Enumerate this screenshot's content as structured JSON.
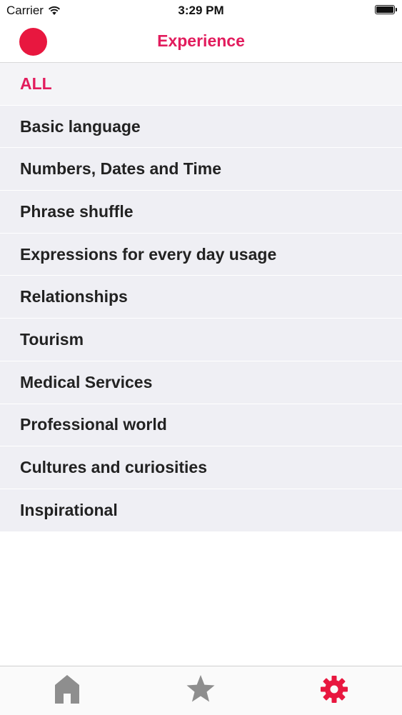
{
  "status_bar": {
    "carrier": "Carrier",
    "time": "3:29 PM"
  },
  "nav": {
    "title": "Experience",
    "title_color": "#e21c5d",
    "record_color": "#e8173f"
  },
  "categories": [
    {
      "label": "ALL",
      "selected": true
    },
    {
      "label": "Basic language"
    },
    {
      "label": "Numbers, Dates and Time"
    },
    {
      "label": "Phrase shuffle"
    },
    {
      "label": "Expressions for every day usage"
    },
    {
      "label": "Relationships"
    },
    {
      "label": "Tourism"
    },
    {
      "label": "Medical Services"
    },
    {
      "label": "Professional world"
    },
    {
      "label": "Cultures and curiosities"
    },
    {
      "label": "Inspirational"
    }
  ],
  "tab_bar": {
    "tabs": [
      {
        "icon": "home-icon",
        "active": false
      },
      {
        "icon": "star-icon",
        "active": false
      },
      {
        "icon": "gear-icon",
        "active": true
      }
    ],
    "active_color": "#e8173f",
    "inactive_color": "#8e8e8e"
  }
}
